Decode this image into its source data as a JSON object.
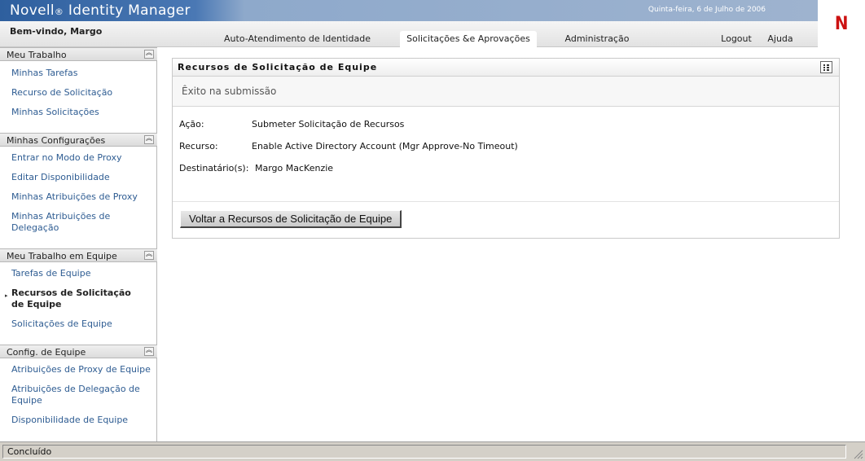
{
  "header": {
    "brand_prefix": "Novell",
    "brand_reg": "®",
    "brand_suffix": "Identity Manager",
    "date": "Quinta-feira, 6 de Julho de 2006",
    "logo_letter": "N",
    "welcome": "Bem-vindo, Margo",
    "tabs": [
      {
        "label": "Auto-Atendimento de Identidade",
        "active": false
      },
      {
        "label": "Solicitações &e Aprovações",
        "active": true
      },
      {
        "label": "Administração",
        "active": false
      }
    ],
    "logout_label": "Logout",
    "help_label": "Ajuda"
  },
  "sidebar": {
    "sections": [
      {
        "title": "Meu Trabalho",
        "items": [
          "Minhas Tarefas",
          "Recurso de Solicitação",
          "Minhas Solicitações"
        ]
      },
      {
        "title": "Minhas Configurações",
        "items": [
          "Entrar no Modo de Proxy",
          "Editar Disponibilidade",
          "Minhas Atribuições de Proxy",
          "Minhas Atribuições de Delegação"
        ]
      },
      {
        "title": "Meu Trabalho em Equipe",
        "items": [
          "Tarefas de Equipe",
          "Recursos de Solicitação de Equipe",
          "Solicitações de Equipe"
        ],
        "current_index": 1
      },
      {
        "title": "Config. de Equipe",
        "items": [
          "Atribuições de Proxy de Equipe",
          "Atribuições de Delegação de Equipe",
          "Disponibilidade de Equipe"
        ]
      }
    ],
    "bullet": "▸"
  },
  "panel": {
    "title": "Recursos de Solicitação de Equipe",
    "success_message": "Êxito na submissão",
    "details": [
      {
        "label": "Ação:",
        "value": "Submeter Solicitação de Recursos"
      },
      {
        "label": "Recurso:",
        "value": "Enable Active Directory Account (Mgr Approve-No Timeout)"
      },
      {
        "label": "Destinatário(s):",
        "value": "Margo MacKenzie"
      }
    ],
    "back_button": "Voltar a Recursos de Solicitação de Equipe"
  },
  "status": {
    "text": "Concluído"
  },
  "colors": {
    "brand_blue": "#2e5f9e",
    "link_blue": "#2e5c92",
    "logo_red": "#cc1111",
    "statusbar_gray": "#d4d0c8"
  },
  "icons": {
    "collapse": "double-chevron-up-icon",
    "panel_menu": "grid-menu-icon",
    "logo": "novell-n-icon"
  }
}
